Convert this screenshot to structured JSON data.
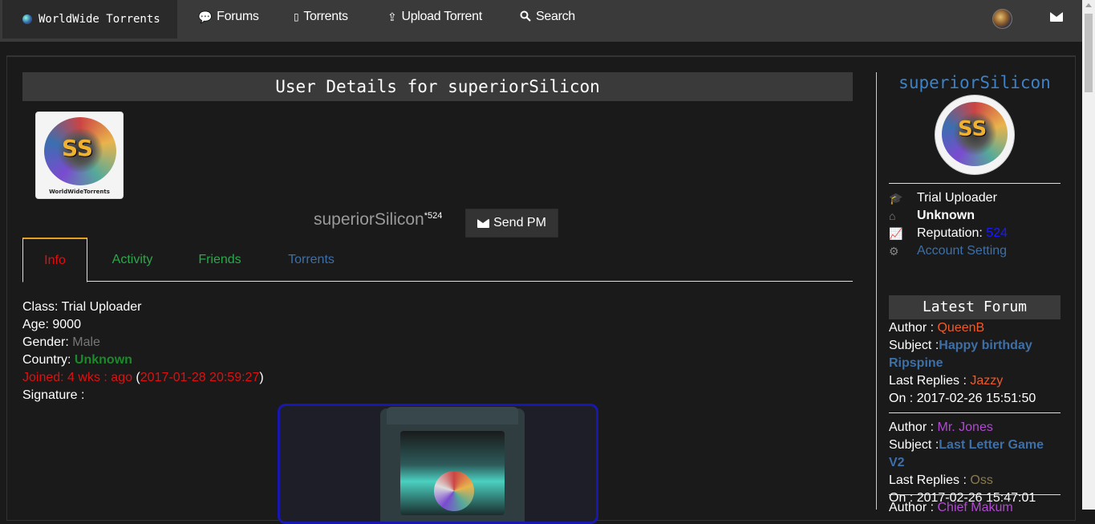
{
  "nav": {
    "brand": "WorldWide Torrents",
    "links": [
      {
        "label": "Forums"
      },
      {
        "label": "Torrents"
      },
      {
        "label": "Upload Torrent"
      },
      {
        "label": "Search"
      }
    ]
  },
  "profile": {
    "title": "User Details for superiorSilicon",
    "username": "superiorSilicon",
    "reputation_sup": "*524",
    "send_pm": "Send PM",
    "avatar_text": "SS",
    "avatar_caption": "WorldWideTorrents",
    "avatar_subtext": "{superiorSilicon}"
  },
  "tabs": [
    {
      "label": "Info",
      "color": "#e01010"
    },
    {
      "label": "Activity",
      "color": "#2aa84a"
    },
    {
      "label": "Friends",
      "color": "#2aa84a"
    },
    {
      "label": "Torrents",
      "color": "#3d6fa8"
    }
  ],
  "info": {
    "class_label": "Class:",
    "class_value": "Trial Uploader",
    "age_label": "Age:",
    "age_value": "9000",
    "gender_label": "Gender:",
    "gender_value": "Male",
    "country_label": "Country:",
    "country_value": "Unknown",
    "joined_label": "Joined:",
    "joined_ago": "4 wks : ago",
    "joined_date": "2017-01-28 20:59:27",
    "signature_label": "Signature :"
  },
  "sidebar": {
    "username": "superiorSilicon",
    "class": "Trial Uploader",
    "country": "Unknown",
    "reputation_label": "Reputation:",
    "reputation_value": "524",
    "account_setting": "Account Setting",
    "latest_forum_title": "Latest Forum",
    "posts": [
      {
        "author_label": "Author :",
        "author": "QueenB",
        "author_color": "#f05a28",
        "subject_label": "Subject :",
        "subject": "Happy birthday Ripspine",
        "replies_label": "Last Replies :",
        "replier": "Jazzy",
        "replier_color": "#f05a28",
        "on_label": "On :",
        "date": "2017-02-26 15:51:50"
      },
      {
        "author_label": "Author :",
        "author": "Mr. Jones",
        "author_color": "#b04ad0",
        "subject_label": "Subject :",
        "subject": "Last Letter Game V2",
        "replies_label": "Last Replies :",
        "replier": "Oss",
        "replier_color": "#8a7a50",
        "on_label": "On :",
        "date": "2017-02-26 15:47:01"
      },
      {
        "author_label": "Author :",
        "author": "Chief Makum",
        "author_color": "#b04ad0"
      }
    ]
  },
  "colors": {
    "navbar": "#3a3a3a",
    "background": "#1a1a1a",
    "link_blue": "#3d6fa8",
    "green": "#2aa84a",
    "red": "#e01010"
  }
}
